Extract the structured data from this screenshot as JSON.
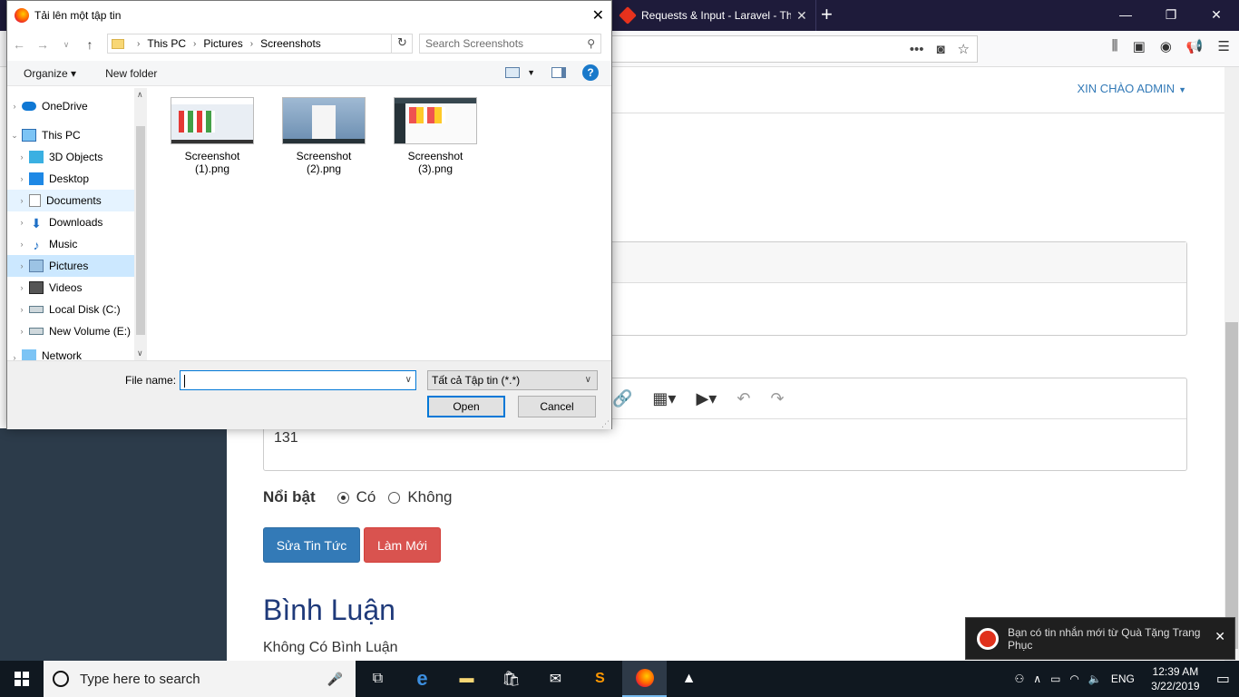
{
  "browser": {
    "tab_title": "Requests & Input - Laravel - Th",
    "greeting": "XIN CHÀO ADMIN"
  },
  "form": {
    "editor_text": "131",
    "featured_label": "Nổi bật",
    "option_yes": "Có",
    "option_no": "Không",
    "featured_selected": "Có",
    "btn_edit": "Sửa Tin Tức",
    "btn_reset": "Làm Mới"
  },
  "comments": {
    "title": "Bình Luận",
    "empty": "Không Có Bình Luận"
  },
  "toast": {
    "text": "Bạn có tin nhắn mới từ Quà Tặng Trang Phục"
  },
  "dialog": {
    "title": "Tải lên một tập tin",
    "breadcrumb": [
      "This PC",
      "Pictures",
      "Screenshots"
    ],
    "search_placeholder": "Search Screenshots",
    "organize": "Organize",
    "new_folder": "New folder",
    "nav": [
      {
        "label": "OneDrive"
      },
      {
        "label": "This PC"
      },
      {
        "label": "3D Objects"
      },
      {
        "label": "Desktop"
      },
      {
        "label": "Documents"
      },
      {
        "label": "Downloads"
      },
      {
        "label": "Music"
      },
      {
        "label": "Pictures"
      },
      {
        "label": "Videos"
      },
      {
        "label": "Local Disk (C:)"
      },
      {
        "label": "New Volume (E:)"
      },
      {
        "label": "Network"
      }
    ],
    "files": [
      {
        "line1": "Screenshot",
        "line2": "(1).png"
      },
      {
        "line1": "Screenshot",
        "line2": "(2).png"
      },
      {
        "line1": "Screenshot",
        "line2": "(3).png"
      }
    ],
    "file_name_label": "File name:",
    "file_name_value": "",
    "file_type": "Tất cả Tập tin (*.*)",
    "open": "Open",
    "cancel": "Cancel"
  },
  "taskbar": {
    "search_placeholder": "Type here to search",
    "lang": "ENG",
    "time": "12:39 AM",
    "date": "3/22/2019"
  }
}
